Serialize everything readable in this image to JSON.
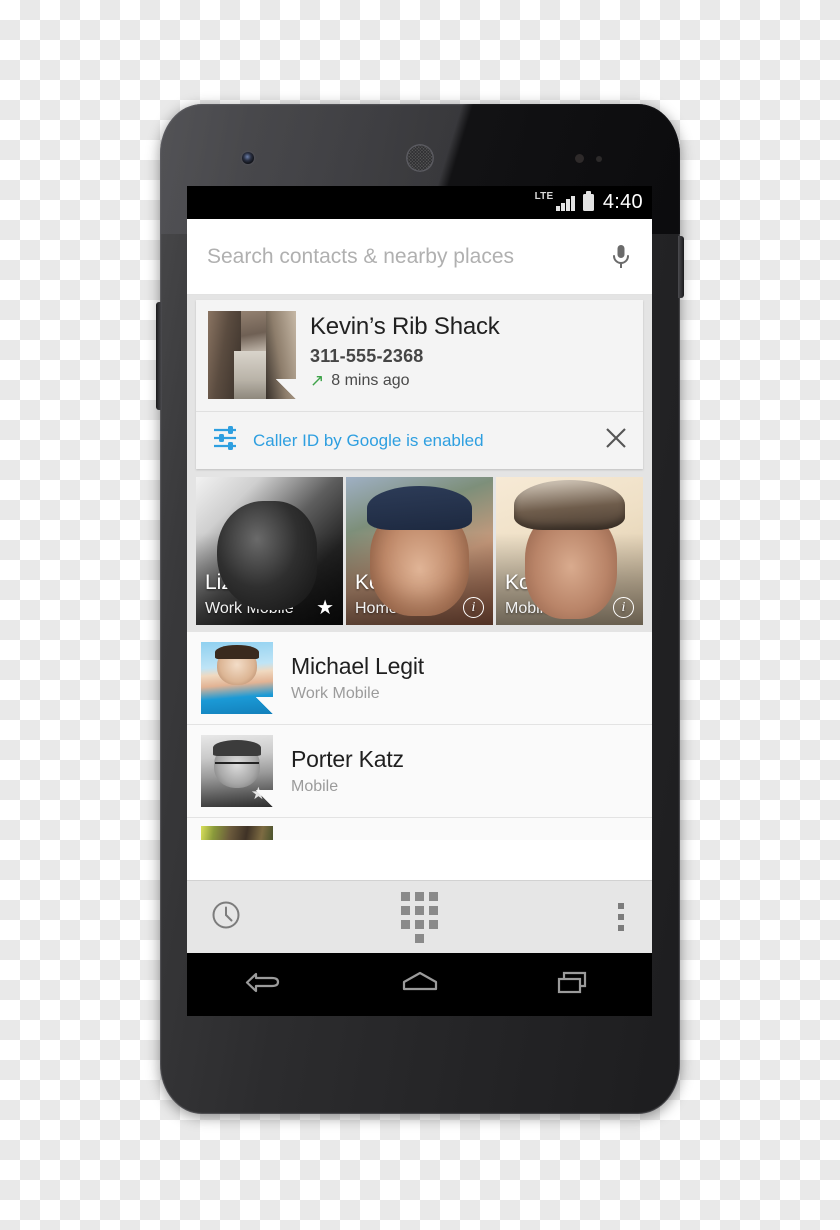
{
  "device": {
    "name": "android-smartphone",
    "hardware": {
      "camera": "front-camera",
      "earpiece": "earpiece-speaker",
      "volume": "volume-rocker",
      "power": "power-button"
    }
  },
  "status_bar": {
    "network_label": "LTE",
    "signal_icon": "signal-bars-icon",
    "battery_icon": "battery-full-icon",
    "clock": "4:40"
  },
  "search": {
    "placeholder": "Search contacts & nearby places",
    "value": "",
    "mic_icon": "microphone-icon"
  },
  "caller_card": {
    "thumbnail": "alley-photo-thumbnail",
    "name": "Kevin’s Rib Shack",
    "phone": "311-555-2368",
    "call_direction_icon": "outgoing-call-arrow",
    "time": "8 mins ago",
    "notice": {
      "icon": "sliders-settings-icon",
      "label": "Caller ID by Google is enabled",
      "dismiss_icon": "close-x-icon"
    }
  },
  "favorites": {
    "tiles": [
      {
        "name": "Liza",
        "sub": "Work Mobile",
        "badge": "★",
        "badge_type": "star",
        "photo": "liza-photo"
      },
      {
        "name": "Kevin",
        "sub": "Home",
        "badge": "i",
        "badge_type": "info",
        "photo": "kevin-photo"
      },
      {
        "name": "Koa",
        "sub": "Mobile",
        "badge": "i",
        "badge_type": "info",
        "photo": "koa-photo"
      }
    ]
  },
  "contacts": [
    {
      "name": "Michael Legit",
      "sub": "Work Mobile",
      "photo": "michael-legit-photo"
    },
    {
      "name": "Porter Katz",
      "sub": "Mobile",
      "photo": "porter-katz-photo"
    }
  ],
  "toolbar": {
    "recents_icon": "clock-recents-icon",
    "dialpad_icon": "dialpad-icon",
    "overflow_icon": "overflow-menu-icon"
  },
  "nav_bar": {
    "back_icon": "back-icon",
    "home_icon": "home-icon",
    "recents_icon": "recent-apps-icon"
  },
  "colors": {
    "accent_blue": "#2e9fe0",
    "call_green": "#3fa34a",
    "chrome_gray": "#e4e4e4",
    "list_bg": "#fafafa"
  }
}
